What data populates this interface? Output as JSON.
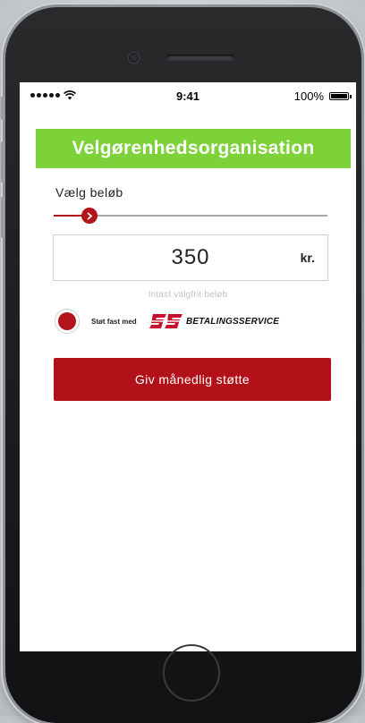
{
  "status_bar": {
    "time": "9:41",
    "battery": "100%",
    "signal_icon": "signal-dots-icon",
    "wifi_icon": "wifi-icon",
    "battery_icon": "battery-icon"
  },
  "header": {
    "title": "Velgørenhedsorganisation",
    "color": "#7dd23a"
  },
  "amount": {
    "label": "Vælg beløb",
    "slider_level": 0.13,
    "slider_thumb_icon": "chevron-right-icon",
    "value": "350",
    "unit": "kr.",
    "hint": "Intast valgfrit beløb"
  },
  "betalingsservice": {
    "selected": true,
    "prefix": "Støt fast med",
    "name": "BETALINGSSERVICE",
    "logo_icon": "betalingsservice-logo-icon"
  },
  "cta": {
    "label": "Giv månedlig støtte",
    "color": "#b2111a"
  }
}
